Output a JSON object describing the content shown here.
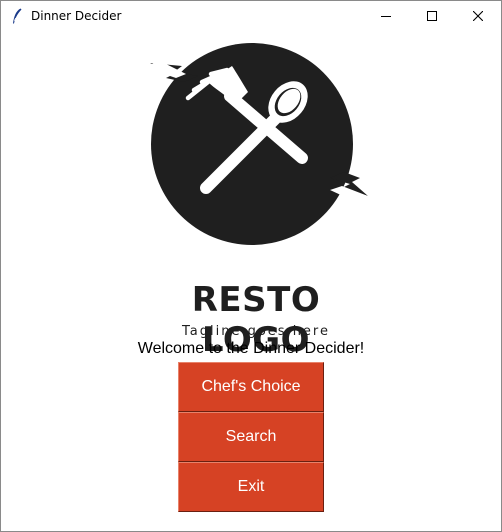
{
  "window": {
    "title": "Dinner Decider",
    "icon": "feather-icon",
    "controls": [
      "minimize-icon",
      "maximize-icon",
      "close-icon"
    ]
  },
  "logo": {
    "title": "RESTO LOGO",
    "tagline": "Tagline goes here",
    "icon": "fork-spoon-icon"
  },
  "welcome_text": "Welcome to the Dinner Decider!",
  "buttons": {
    "chefs_choice": "Chef's Choice",
    "search": "Search",
    "exit": "Exit"
  },
  "colors": {
    "button_bg": "#d64224",
    "button_text": "#ffffff",
    "logo_dark": "#1f1f1f"
  }
}
